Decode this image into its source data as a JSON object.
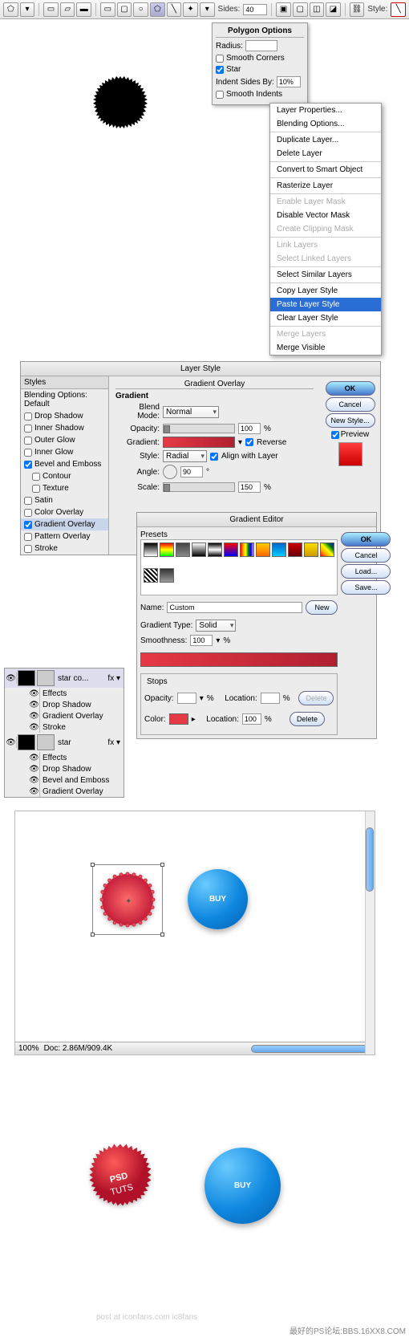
{
  "toolbar": {
    "sides_label": "Sides:",
    "sides_value": "40",
    "style_label": "Style:"
  },
  "polygon_options": {
    "title": "Polygon Options",
    "radius_label": "Radius:",
    "radius_value": "",
    "smooth_corners": "Smooth Corners",
    "star": "Star",
    "star_checked": true,
    "indent_label": "Indent Sides By:",
    "indent_value": "10%",
    "smooth_indents": "Smooth Indents"
  },
  "context_menu": {
    "items": [
      {
        "label": "Layer Properties...",
        "state": "normal"
      },
      {
        "label": "Blending Options...",
        "state": "normal"
      },
      {
        "label": "sep"
      },
      {
        "label": "Duplicate Layer...",
        "state": "normal"
      },
      {
        "label": "Delete Layer",
        "state": "normal"
      },
      {
        "label": "sep"
      },
      {
        "label": "Convert to Smart Object",
        "state": "normal"
      },
      {
        "label": "sep"
      },
      {
        "label": "Rasterize Layer",
        "state": "normal"
      },
      {
        "label": "sep"
      },
      {
        "label": "Enable Layer Mask",
        "state": "disabled"
      },
      {
        "label": "Disable Vector Mask",
        "state": "normal"
      },
      {
        "label": "Create Clipping Mask",
        "state": "disabled"
      },
      {
        "label": "sep"
      },
      {
        "label": "Link Layers",
        "state": "disabled"
      },
      {
        "label": "Select Linked Layers",
        "state": "disabled"
      },
      {
        "label": "sep"
      },
      {
        "label": "Select Similar Layers",
        "state": "normal"
      },
      {
        "label": "sep"
      },
      {
        "label": "Copy Layer Style",
        "state": "normal"
      },
      {
        "label": "Paste Layer Style",
        "state": "selected"
      },
      {
        "label": "Clear Layer Style",
        "state": "normal"
      },
      {
        "label": "sep"
      },
      {
        "label": "Merge Layers",
        "state": "disabled"
      },
      {
        "label": "Merge Visible",
        "state": "normal"
      }
    ]
  },
  "layer_style": {
    "title": "Layer Style",
    "left_header": "Styles",
    "items": [
      {
        "label": "Blending Options: Default",
        "checked": false,
        "header": true
      },
      {
        "label": "Drop Shadow",
        "checked": false
      },
      {
        "label": "Inner Shadow",
        "checked": false
      },
      {
        "label": "Outer Glow",
        "checked": false
      },
      {
        "label": "Inner Glow",
        "checked": false
      },
      {
        "label": "Bevel and Emboss",
        "checked": true
      },
      {
        "label": "Contour",
        "checked": false,
        "sub": true
      },
      {
        "label": "Texture",
        "checked": false,
        "sub": true
      },
      {
        "label": "Satin",
        "checked": false
      },
      {
        "label": "Color Overlay",
        "checked": false
      },
      {
        "label": "Gradient Overlay",
        "checked": true,
        "selected": true
      },
      {
        "label": "Pattern Overlay",
        "checked": false
      },
      {
        "label": "Stroke",
        "checked": false
      }
    ],
    "section_title": "Gradient Overlay",
    "sub_title": "Gradient",
    "blend_mode_label": "Blend Mode:",
    "blend_mode": "Normal",
    "opacity_label": "Opacity:",
    "opacity_value": "100",
    "gradient_label": "Gradient:",
    "reverse": "Reverse",
    "reverse_checked": true,
    "style_label": "Style:",
    "style_value": "Radial",
    "align_layer": "Align with Layer",
    "align_checked": true,
    "angle_label": "Angle:",
    "angle_value": "90",
    "scale_label": "Scale:",
    "scale_value": "150",
    "percent": "%",
    "deg": "°",
    "ok": "OK",
    "cancel": "Cancel",
    "new_style": "New Style...",
    "preview": "Preview",
    "preview_checked": true
  },
  "gradient_editor": {
    "title": "Gradient Editor",
    "presets_label": "Presets",
    "ok": "OK",
    "cancel": "Cancel",
    "load": "Load...",
    "save": "Save...",
    "name_label": "Name:",
    "name_value": "Custom",
    "new_btn": "New",
    "type_label": "Gradient Type:",
    "type_value": "Solid",
    "smoothness_label": "Smoothness:",
    "smoothness_value": "100",
    "percent": "%",
    "stops_label": "Stops",
    "opacity_label": "Opacity:",
    "location_label": "Location:",
    "location_value": "100",
    "color_label": "Color:",
    "delete": "Delete"
  },
  "layers_panel": {
    "layers": [
      {
        "name": "star co...",
        "effects": [
          "Drop Shadow",
          "Gradient Overlay",
          "Stroke"
        ]
      },
      {
        "name": "star",
        "effects": [
          "Drop Shadow",
          "Bevel and Emboss",
          "Gradient Overlay"
        ]
      }
    ],
    "effects_label": "Effects",
    "fx": "fx"
  },
  "canvas": {
    "buy_text": "BUY",
    "zoom": "100%",
    "doc_info": "Doc: 2.86M/909.4K"
  },
  "final": {
    "psd_label": "PSD",
    "psd_sub": "TUTS",
    "buy_label": "BUY"
  },
  "watermark": "post at iconfans.com ic8fans",
  "corner_mark": "最好的PS论坛:BBS.16XX8.COM"
}
